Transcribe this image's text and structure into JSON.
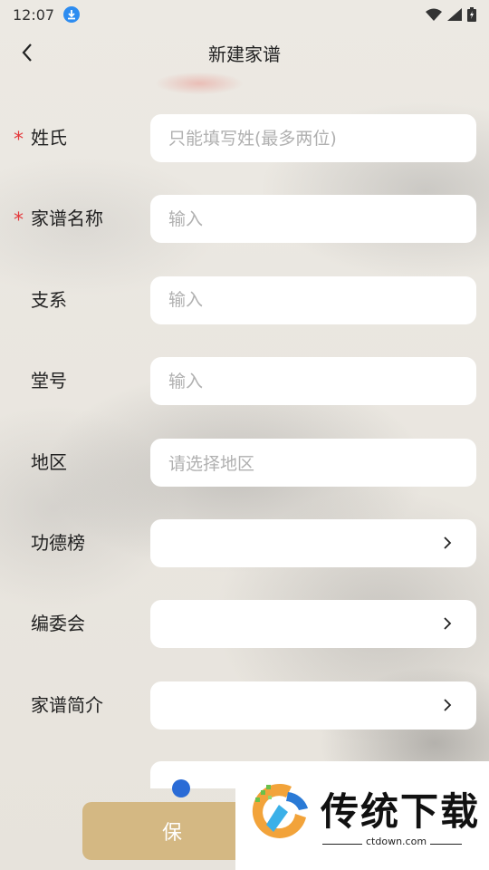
{
  "status_bar": {
    "time": "12:07"
  },
  "header": {
    "title": "新建家谱"
  },
  "form": {
    "surname": {
      "label": "姓氏",
      "required": "*",
      "placeholder": "只能填写姓(最多两位)"
    },
    "genealogy_name": {
      "label": "家谱名称",
      "required": "*",
      "placeholder": "输入"
    },
    "branch": {
      "label": "支系",
      "placeholder": "输入"
    },
    "hall_name": {
      "label": "堂号",
      "placeholder": "输入"
    },
    "region": {
      "label": "地区",
      "placeholder": "请选择地区"
    },
    "merit_list": {
      "label": "功德榜"
    },
    "editorial_board": {
      "label": "编委会"
    },
    "intro": {
      "label": "家谱简介"
    }
  },
  "save_button": {
    "label": "保"
  },
  "watermark": {
    "brand": "传统下载",
    "url": "ctdown.com"
  },
  "colors": {
    "accent": "#d4b883",
    "required": "#e4393c",
    "placeholder": "#b0b0b0"
  }
}
